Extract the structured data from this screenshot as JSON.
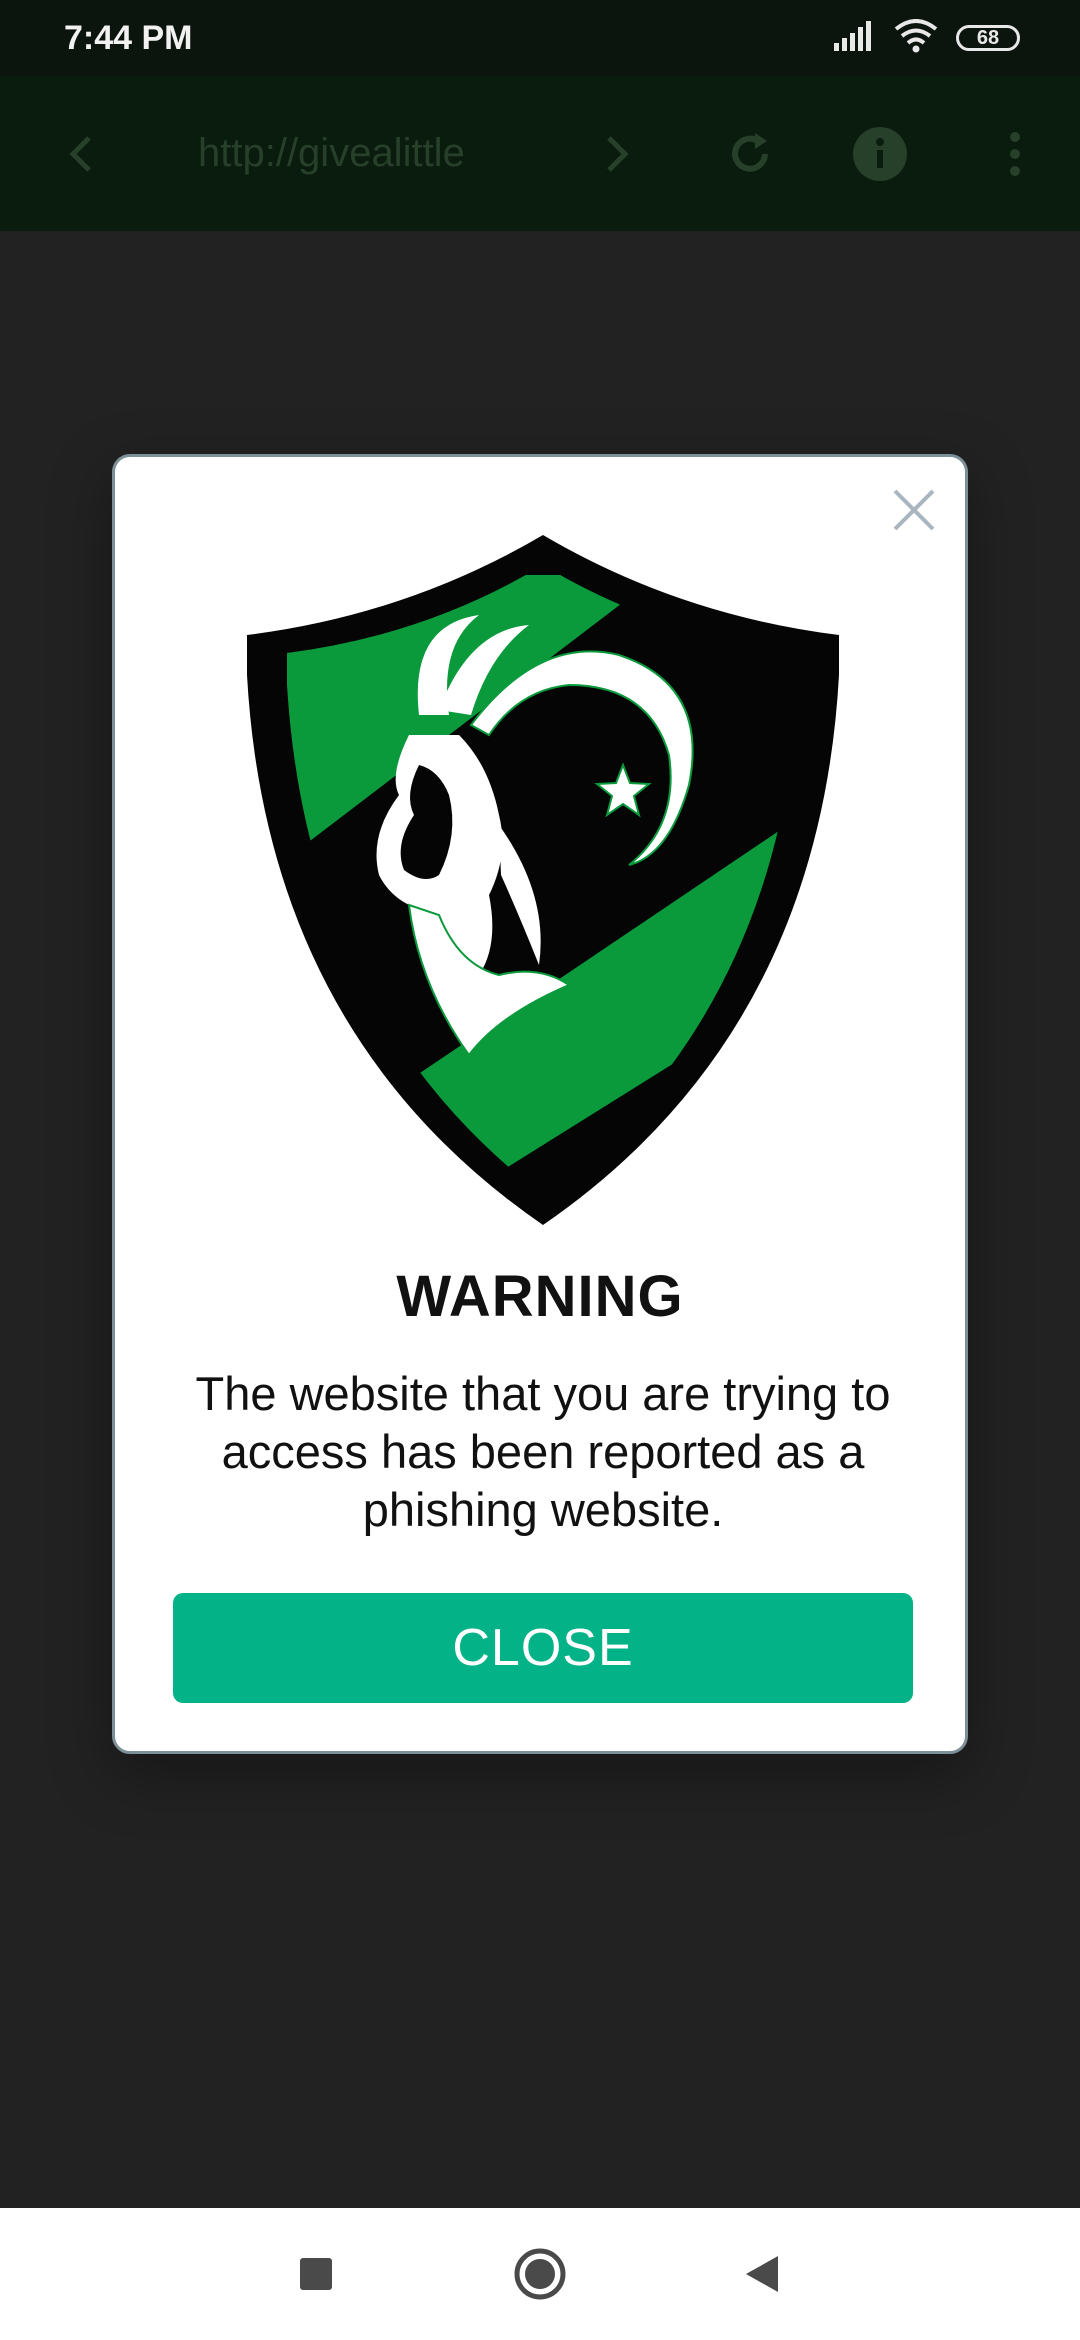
{
  "status_bar": {
    "time": "7:44 PM",
    "battery": "68",
    "icons": [
      "signal-icon",
      "wifi-icon",
      "battery-icon"
    ]
  },
  "browser": {
    "url": "http://givealittle",
    "icons": [
      "back-icon",
      "forward-icon",
      "reload-icon",
      "info-icon",
      "more-icon"
    ]
  },
  "dialog": {
    "title": "WARNING",
    "message": "The website that you are trying to access has been reported as a phishing website.",
    "close_button_label": "CLOSE",
    "logo": "goat-shield-logo",
    "colors": {
      "shield_green": "#0a9a3c",
      "button": "#03b387"
    }
  },
  "nav_bar": {
    "icons": [
      "recents-icon",
      "home-icon",
      "back-triangle-icon"
    ]
  }
}
